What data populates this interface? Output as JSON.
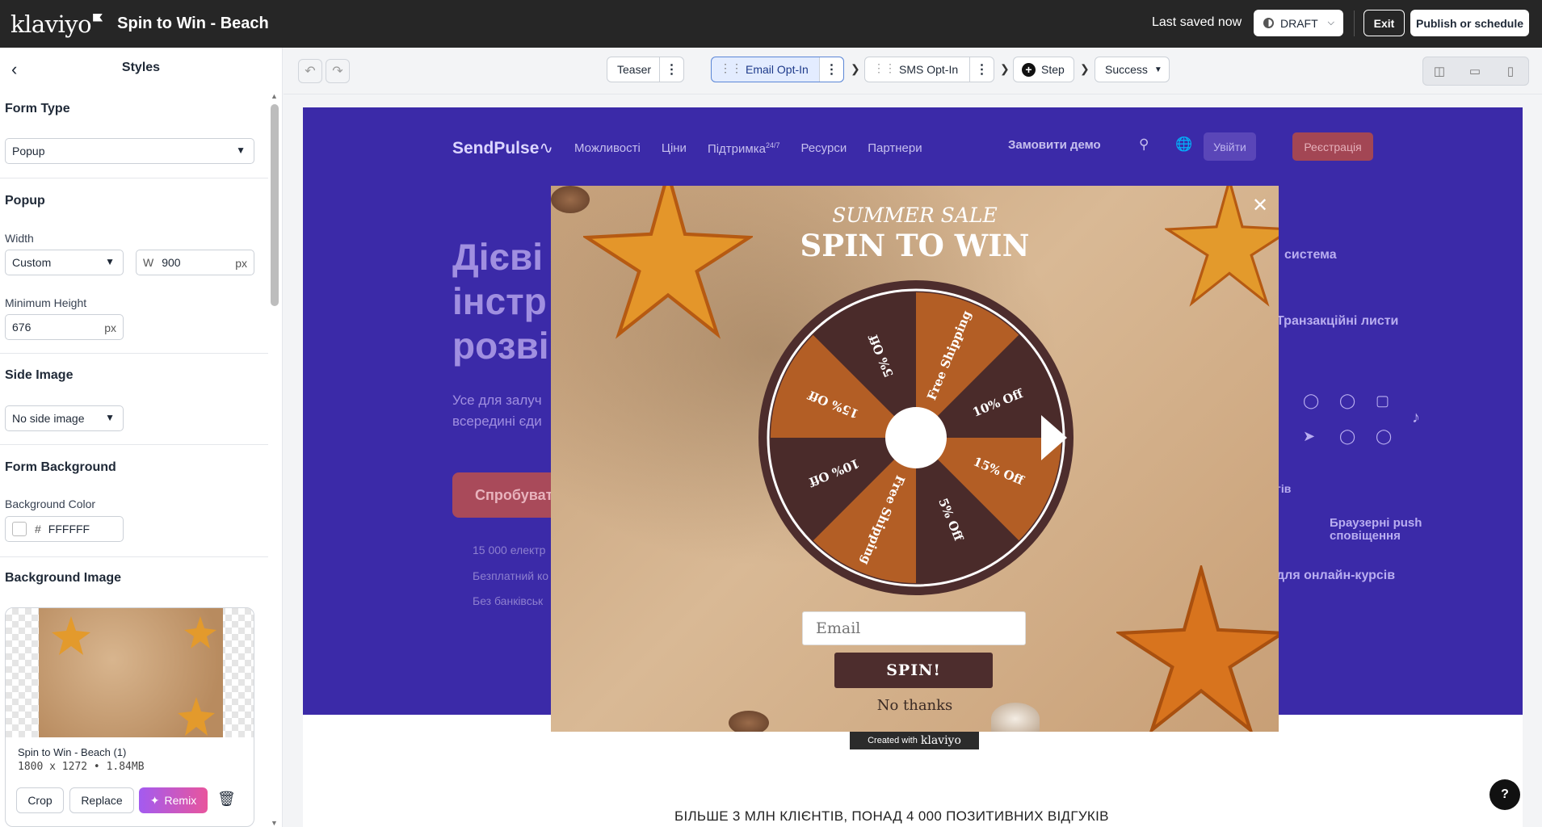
{
  "topbar": {
    "logo": "klaviyo",
    "title": "Spin to Win - Beach",
    "last_saved": "Last saved now",
    "status": "DRAFT",
    "exit": "Exit",
    "publish": "Publish or schedule"
  },
  "panel": {
    "title": "Styles",
    "form_type": {
      "title": "Form Type",
      "value": "Popup"
    },
    "popup": {
      "title": "Popup",
      "width_label": "Width",
      "width_mode": "Custom",
      "width_prefix": "W",
      "width_value": "900",
      "unit": "px",
      "min_height_label": "Minimum Height",
      "min_height_value": "676"
    },
    "side_image": {
      "title": "Side Image",
      "value": "No side image"
    },
    "form_background": {
      "title": "Form Background",
      "color_label": "Background Color",
      "color_hash": "#",
      "color_value": "FFFFFF"
    },
    "background_image": {
      "title": "Background Image",
      "file_name": "Spin to Win - Beach (1)",
      "file_meta": "1800 x 1272 • 1.84MB",
      "crop": "Crop",
      "replace": "Replace",
      "remix": "Remix"
    }
  },
  "steps": {
    "teaser": "Teaser",
    "email": "Email Opt-In",
    "sms": "SMS Opt-In",
    "add_step": "Step",
    "success": "Success"
  },
  "site": {
    "logo": "SendPulse",
    "nav": [
      "Можливості",
      "Ціни",
      "Підтримка",
      "Ресурси",
      "Партнери"
    ],
    "support_badge": "24/7",
    "demo": "Замовити демо",
    "login": "Увійти",
    "register": "Реєстрація",
    "hero_lines": [
      "Дієві",
      "інстр",
      "розві"
    ],
    "hero_sub_lines": [
      "Усе для залуч",
      "всередині єди"
    ],
    "hero_btn": "Спробуват",
    "hero_small": [
      "15 000 електр",
      "Безплатний ко",
      "Без банківськ"
    ],
    "right_texts": [
      "система",
      "Транзакційні листи",
      "гів",
      "Браузерні push",
      "сповіщення",
      "для онлайн-курсів"
    ],
    "bottom": "БІЛЬШЕ 3 МЛН КЛІЄНТІВ, ПОНАД 4 000 ПОЗИТИВНИХ ВІДГУКІВ"
  },
  "popup": {
    "subtitle": "SUMMER SALE",
    "title": "SPIN TO WIN",
    "email_placeholder": "Email",
    "spin": "SPIN!",
    "no_thanks": "No thanks",
    "created_with": "Created with",
    "created_brand": "klaviyo",
    "wheel_segments": [
      "Free Shipping",
      "10% Off",
      "15% Off",
      "5% Off",
      "Free Shipping",
      "10% Off",
      "15% Off",
      "5% Off"
    ],
    "colors": {
      "dark": "#4a2b2a",
      "orange": "#b35e25",
      "rim": "#4d2d2d"
    }
  },
  "help": "?"
}
